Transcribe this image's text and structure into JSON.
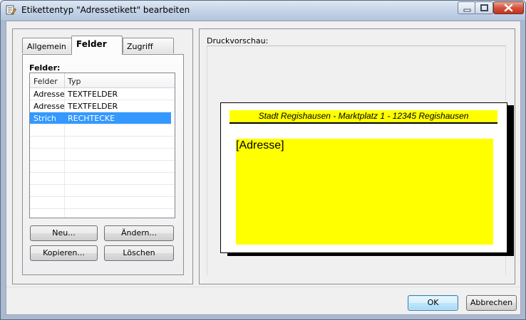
{
  "window": {
    "title": "Etikettentyp \"Adressetikett\" bearbeiten"
  },
  "tabs": [
    {
      "label": "Allgemein",
      "active": false
    },
    {
      "label": "Felder",
      "active": true
    },
    {
      "label": "Zugriff",
      "active": false
    }
  ],
  "fields_panel": {
    "heading": "Felder:",
    "columns": [
      "Felder",
      "Typ"
    ],
    "rows": [
      {
        "feld": "Adresse",
        "typ": "TEXTFELDER",
        "selected": false
      },
      {
        "feld": "Adresse",
        "typ": "TEXTFELDER",
        "selected": false
      },
      {
        "feld": "Strich",
        "typ": "RECHTECKE",
        "selected": true
      }
    ],
    "buttons": {
      "new": "Neu...",
      "change": "Ändern...",
      "copy": "Kopieren...",
      "delete": "Löschen"
    }
  },
  "preview": {
    "heading": "Druckvorschau:",
    "sender_line": "Stadt Regishausen - Marktplatz 1 - 12345 Regishausen",
    "address_placeholder": "[Adresse]"
  },
  "dialog_buttons": {
    "ok": "OK",
    "cancel": "Abbrechen"
  },
  "colors": {
    "selection": "#3399ff",
    "field_fill": "#ffff00"
  },
  "icons": {
    "app": "label-edit-icon",
    "minimize": "minimize-icon",
    "maximize": "maximize-icon",
    "close": "close-icon"
  }
}
